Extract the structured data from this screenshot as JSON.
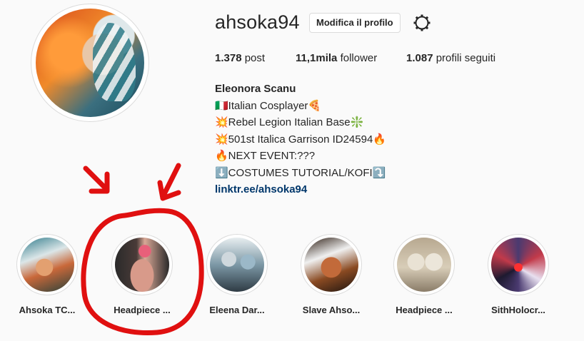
{
  "profile": {
    "username": "ahsoka94",
    "edit_button": "Modifica il profilo",
    "settings_icon": "gear-icon",
    "avatar_icon": "profile-avatar"
  },
  "stats": {
    "posts_count": "1.378",
    "posts_label": "post",
    "followers_count": "11,1mila",
    "followers_label": "follower",
    "following_count": "1.087",
    "following_label": "profili seguiti"
  },
  "bio": {
    "name": "Eleonora Scanu",
    "lines": [
      "🇮🇹Italian Cosplayer🍕",
      "💥Rebel Legion Italian Base❇️",
      "💥501st Italica Garrison ID24594🔥",
      "🔥NEXT EVENT:???",
      "⬇️COSTUMES TUTORIAL/KOFI⤵️"
    ],
    "link": "linktr.ee/ahsoka94"
  },
  "highlights": [
    {
      "label": "Ahsoka TC..."
    },
    {
      "label": "Headpiece ..."
    },
    {
      "label": "Eleena Dar..."
    },
    {
      "label": "Slave Ahso..."
    },
    {
      "label": "Headpiece ..."
    },
    {
      "label": "SithHolocr..."
    }
  ],
  "annotation": {
    "color": "#e01010"
  }
}
